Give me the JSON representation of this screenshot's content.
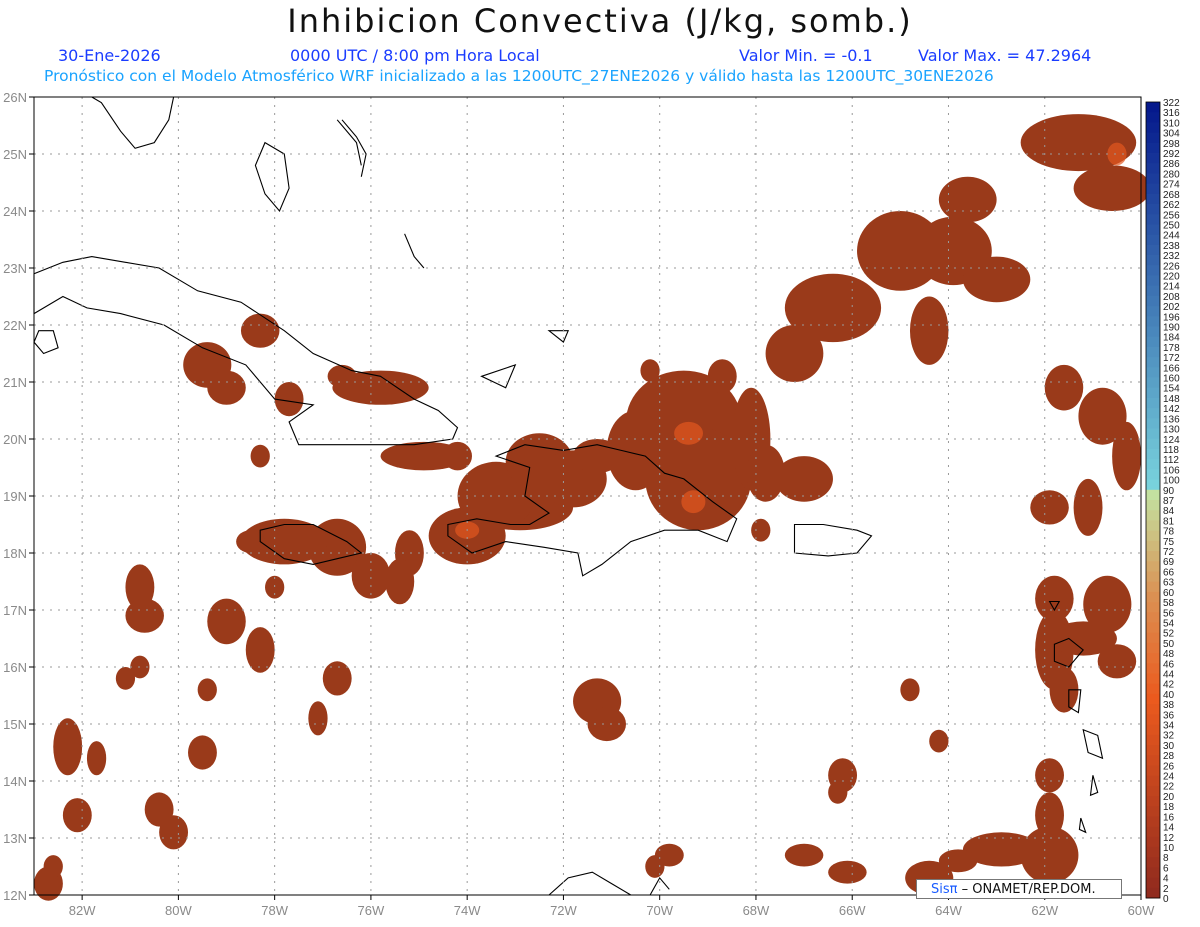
{
  "header": {
    "title": "Inhibicion Convectiva (J/kg, somb.)",
    "date": "30-Ene-2026",
    "time": "0000 UTC / 8:00 pm Hora Local",
    "valmin": "Valor Min. = -0.1",
    "valmax": "Valor Max. = 47.2964",
    "forecast": "Pronóstico con el Modelo Atmosférico WRF inicializado a las 1200UTC_27ENE2026 y válido hasta las  1200UTC_30ENE2026"
  },
  "map": {
    "lon_range": [
      -83,
      -60
    ],
    "lat_range": [
      12,
      26
    ],
    "lon_ticks": [
      "82W",
      "80W",
      "78W",
      "76W",
      "74W",
      "72W",
      "70W",
      "68W",
      "66W",
      "64W",
      "62W",
      "60W"
    ],
    "lat_ticks": [
      "26N",
      "25N",
      "24N",
      "23N",
      "22N",
      "21N",
      "20N",
      "19N",
      "18N",
      "17N",
      "16N",
      "15N",
      "14N",
      "13N",
      "12N"
    ],
    "grid": true,
    "field_color": "#9a3a1a",
    "field_highlight": "#e2571f",
    "coast_color": "#000000"
  },
  "colorbar": {
    "labels": [
      "322",
      "316",
      "310",
      "304",
      "298",
      "292",
      "286",
      "280",
      "274",
      "268",
      "262",
      "256",
      "250",
      "244",
      "238",
      "232",
      "226",
      "220",
      "214",
      "208",
      "202",
      "196",
      "190",
      "184",
      "178",
      "172",
      "166",
      "160",
      "154",
      "148",
      "142",
      "136",
      "130",
      "124",
      "118",
      "112",
      "106",
      "100",
      "90",
      "87",
      "84",
      "81",
      "78",
      "75",
      "72",
      "69",
      "66",
      "63",
      "60",
      "58",
      "56",
      "54",
      "52",
      "50",
      "48",
      "46",
      "44",
      "42",
      "40",
      "38",
      "36",
      "34",
      "32",
      "30",
      "28",
      "26",
      "24",
      "22",
      "20",
      "18",
      "16",
      "14",
      "12",
      "10",
      "8",
      "6",
      "4",
      "2",
      "0"
    ]
  },
  "credit": {
    "logo": "Sisπ",
    "text": " – ONAMET/REP.DOM."
  }
}
